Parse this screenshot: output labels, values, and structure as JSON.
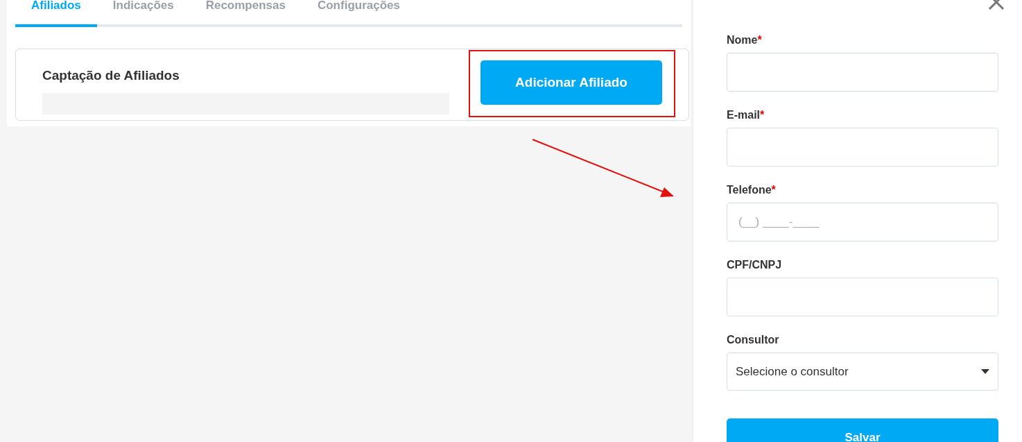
{
  "tabs": [
    {
      "label": "Afiliados",
      "selected": true
    },
    {
      "label": "Indicações",
      "selected": false
    },
    {
      "label": "Recompensas",
      "selected": false
    },
    {
      "label": "Configurações",
      "selected": false
    }
  ],
  "card": {
    "title": "Captação de Afiliados",
    "button": "Adicionar Afiliado"
  },
  "drawer": {
    "fields": [
      {
        "kind": "text",
        "label": "Nome",
        "required_mark": "*"
      },
      {
        "kind": "text",
        "label": "E-mail",
        "required_mark": "*"
      },
      {
        "kind": "text",
        "label": "Telefone",
        "required_mark": "*",
        "placeholder": "(__) ____-____"
      },
      {
        "kind": "text",
        "label": "CPF/CNPJ"
      },
      {
        "kind": "select",
        "label": "Consultor",
        "value": "Selecione o consultor"
      }
    ],
    "submit": "Salvar"
  }
}
